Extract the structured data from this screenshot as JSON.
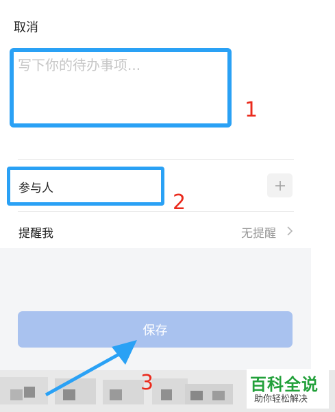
{
  "header": {
    "cancel_label": "取消"
  },
  "todo": {
    "placeholder": "写下你的待办事项..."
  },
  "participants": {
    "label": "参与人",
    "add_icon": "plus-icon"
  },
  "reminder": {
    "label": "提醒我",
    "value": "无提醒",
    "icon": "chevron-right-icon"
  },
  "footer": {
    "save_label": "保存"
  },
  "annotations": {
    "one": "1",
    "two": "2",
    "three": "3"
  },
  "watermark": {
    "title": "百科全说",
    "subtitle": "助你轻松解决"
  },
  "colors": {
    "highlight_border": "#2aa1f5",
    "annotation_red": "#ea2a1c",
    "save_button_bg": "#a9c2ef",
    "watermark_green": "#22a03a"
  }
}
